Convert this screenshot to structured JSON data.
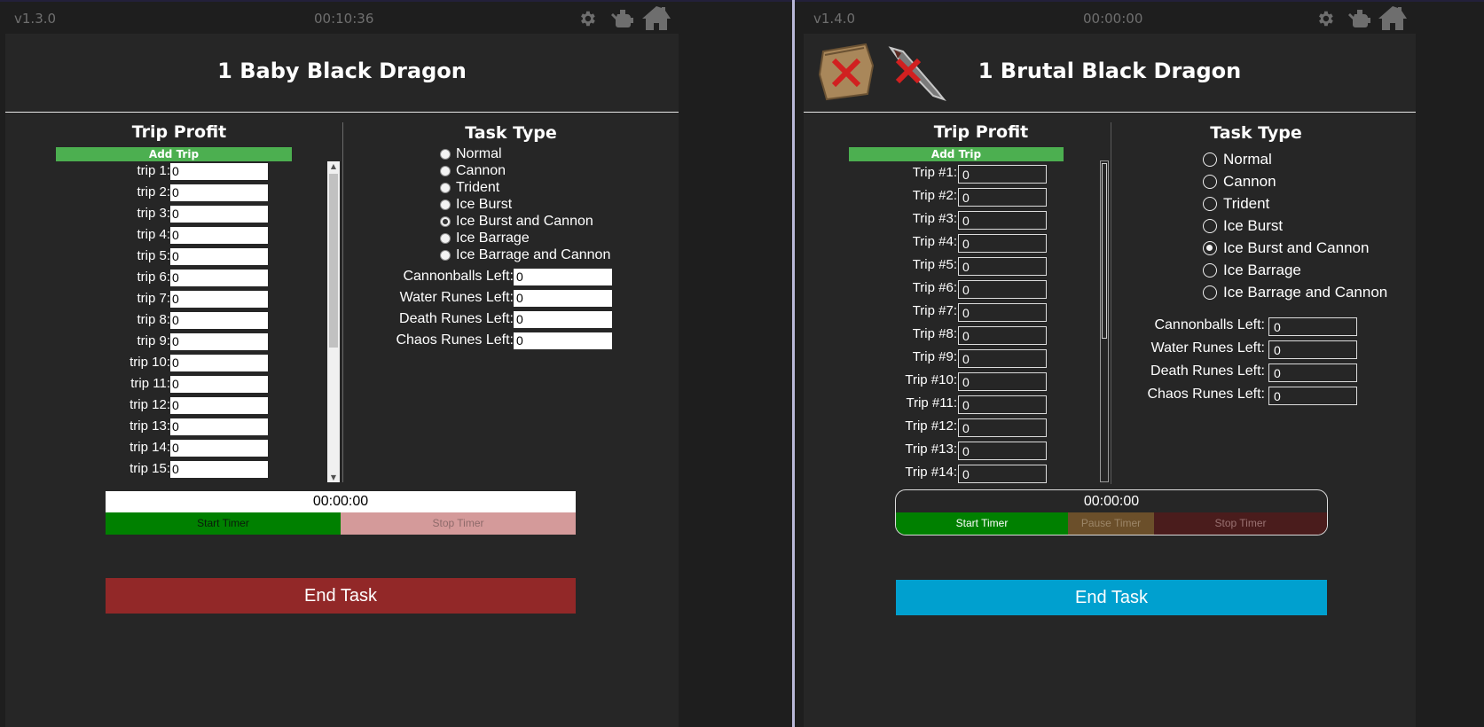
{
  "left_app": {
    "version": "v1.3.0",
    "elapsed": "00:10:36",
    "title": "1 Baby Black Dragon",
    "trip_profit": {
      "heading": "Trip Profit",
      "add_label": "Add Trip",
      "trips": [
        {
          "label": "trip 1:",
          "value": "0"
        },
        {
          "label": "trip 2:",
          "value": "0"
        },
        {
          "label": "trip 3:",
          "value": "0"
        },
        {
          "label": "trip 4:",
          "value": "0"
        },
        {
          "label": "trip 5:",
          "value": "0"
        },
        {
          "label": "trip 6:",
          "value": "0"
        },
        {
          "label": "trip 7:",
          "value": "0"
        },
        {
          "label": "trip 8:",
          "value": "0"
        },
        {
          "label": "trip 9:",
          "value": "0"
        },
        {
          "label": "trip 10:",
          "value": "0"
        },
        {
          "label": "trip 11:",
          "value": "0"
        },
        {
          "label": "trip 12:",
          "value": "0"
        },
        {
          "label": "trip 13:",
          "value": "0"
        },
        {
          "label": "trip 14:",
          "value": "0"
        },
        {
          "label": "trip 15:",
          "value": "0"
        }
      ]
    },
    "task_type": {
      "heading": "Task Type",
      "options": [
        "Normal",
        "Cannon",
        "Trident",
        "Ice Burst",
        "Ice Burst and Cannon",
        "Ice Barrage",
        "Ice Barrage and Cannon"
      ],
      "selected": "Ice Burst and Cannon"
    },
    "resources": [
      {
        "label": "Cannonballs Left:",
        "value": "0"
      },
      {
        "label": "Water Runes Left:",
        "value": "0"
      },
      {
        "label": "Death Runes Left:",
        "value": "0"
      },
      {
        "label": "Chaos Runes Left:",
        "value": "0"
      }
    ],
    "timer": {
      "display": "00:00:00",
      "start_label": "Start Timer",
      "stop_label": "Stop Timer"
    },
    "end_label": "End Task",
    "colors": {
      "start": "#008000",
      "stop": "#d49a9a",
      "end": "#922828",
      "add": "#4caf50"
    }
  },
  "right_app": {
    "version": "v1.4.0",
    "elapsed": "00:00:00",
    "title": "1 Brutal Black Dragon",
    "trip_profit": {
      "heading": "Trip Profit",
      "add_label": "Add Trip",
      "trips": [
        {
          "label": "Trip #1:",
          "value": "0"
        },
        {
          "label": "Trip #2:",
          "value": "0"
        },
        {
          "label": "Trip #3:",
          "value": "0"
        },
        {
          "label": "Trip #4:",
          "value": "0"
        },
        {
          "label": "Trip #5:",
          "value": "0"
        },
        {
          "label": "Trip #6:",
          "value": "0"
        },
        {
          "label": "Trip #7:",
          "value": "0"
        },
        {
          "label": "Trip #8:",
          "value": "0"
        },
        {
          "label": "Trip #9:",
          "value": "0"
        },
        {
          "label": "Trip #10:",
          "value": "0"
        },
        {
          "label": "Trip #11:",
          "value": "0"
        },
        {
          "label": "Trip #12:",
          "value": "0"
        },
        {
          "label": "Trip #13:",
          "value": "0"
        },
        {
          "label": "Trip #14:",
          "value": "0"
        }
      ]
    },
    "task_type": {
      "heading": "Task Type",
      "options": [
        "Normal",
        "Cannon",
        "Trident",
        "Ice Burst",
        "Ice Burst and Cannon",
        "Ice Barrage",
        "Ice Barrage and Cannon"
      ],
      "selected": "Ice Burst and Cannon"
    },
    "resources": [
      {
        "label": "Cannonballs Left:",
        "value": "0"
      },
      {
        "label": "Water Runes Left:",
        "value": "0"
      },
      {
        "label": "Death Runes Left:",
        "value": "0"
      },
      {
        "label": "Chaos Runes Left:",
        "value": "0"
      }
    ],
    "timer": {
      "display": "00:00:00",
      "start_label": "Start Timer",
      "pause_label": "Pause Timer",
      "stop_label": "Stop Timer"
    },
    "end_label": "End Task",
    "colors": {
      "start": "#008000",
      "pause": "#6b4f2a",
      "stop": "#4a1c1c",
      "end": "#00a0cf",
      "add": "#4caf50"
    },
    "status_icons": [
      "inventory-disabled-icon",
      "weapon-disabled-icon"
    ]
  },
  "icons": [
    "settings-gear-icon",
    "watering-can-icon",
    "home-icon"
  ]
}
